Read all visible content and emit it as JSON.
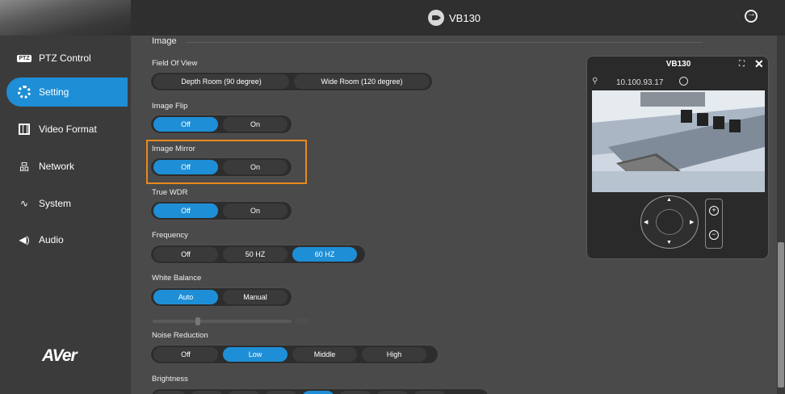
{
  "header": {
    "title": "VB130"
  },
  "sidebar": {
    "items": [
      {
        "label": "PTZ Control",
        "icon": "ptz-icon",
        "badge": "PTZ"
      },
      {
        "label": "Setting",
        "icon": "gear-icon"
      },
      {
        "label": "Video Format",
        "icon": "film-icon"
      },
      {
        "label": "Network",
        "icon": "network-icon"
      },
      {
        "label": "System",
        "icon": "pulse-icon"
      },
      {
        "label": "Audio",
        "icon": "speaker-icon"
      }
    ],
    "active_index": 1,
    "logo": "AVer"
  },
  "main": {
    "section": "Image",
    "fields": {
      "fov": {
        "label": "Field Of View",
        "options": [
          "Depth Room (90 degree)",
          "Wide Room (120 degree)"
        ],
        "selected": null
      },
      "flip": {
        "label": "Image Flip",
        "options": [
          "Off",
          "On"
        ],
        "selected": 0
      },
      "mirror": {
        "label": "Image Mirror",
        "options": [
          "Off",
          "On"
        ],
        "selected": 0
      },
      "wdr": {
        "label": "True WDR",
        "options": [
          "Off",
          "On"
        ],
        "selected": 0
      },
      "frequency": {
        "label": "Frequency",
        "options": [
          "Off",
          "50 HZ",
          "60 HZ"
        ],
        "selected": 2
      },
      "wb": {
        "label": "White Balance",
        "options": [
          "Auto",
          "Manual"
        ],
        "selected": 0
      },
      "nr": {
        "label": "Noise Reduction",
        "options": [
          "Off",
          "Low",
          "Middle",
          "High"
        ],
        "selected": 1
      },
      "brightness": {
        "label": "Brightness"
      }
    },
    "wb_slider_value": "5000"
  },
  "preview": {
    "title": "VB130",
    "ip": "10.100.93.17"
  },
  "colors": {
    "accent": "#1e8fd6",
    "highlight": "#e8891e"
  }
}
